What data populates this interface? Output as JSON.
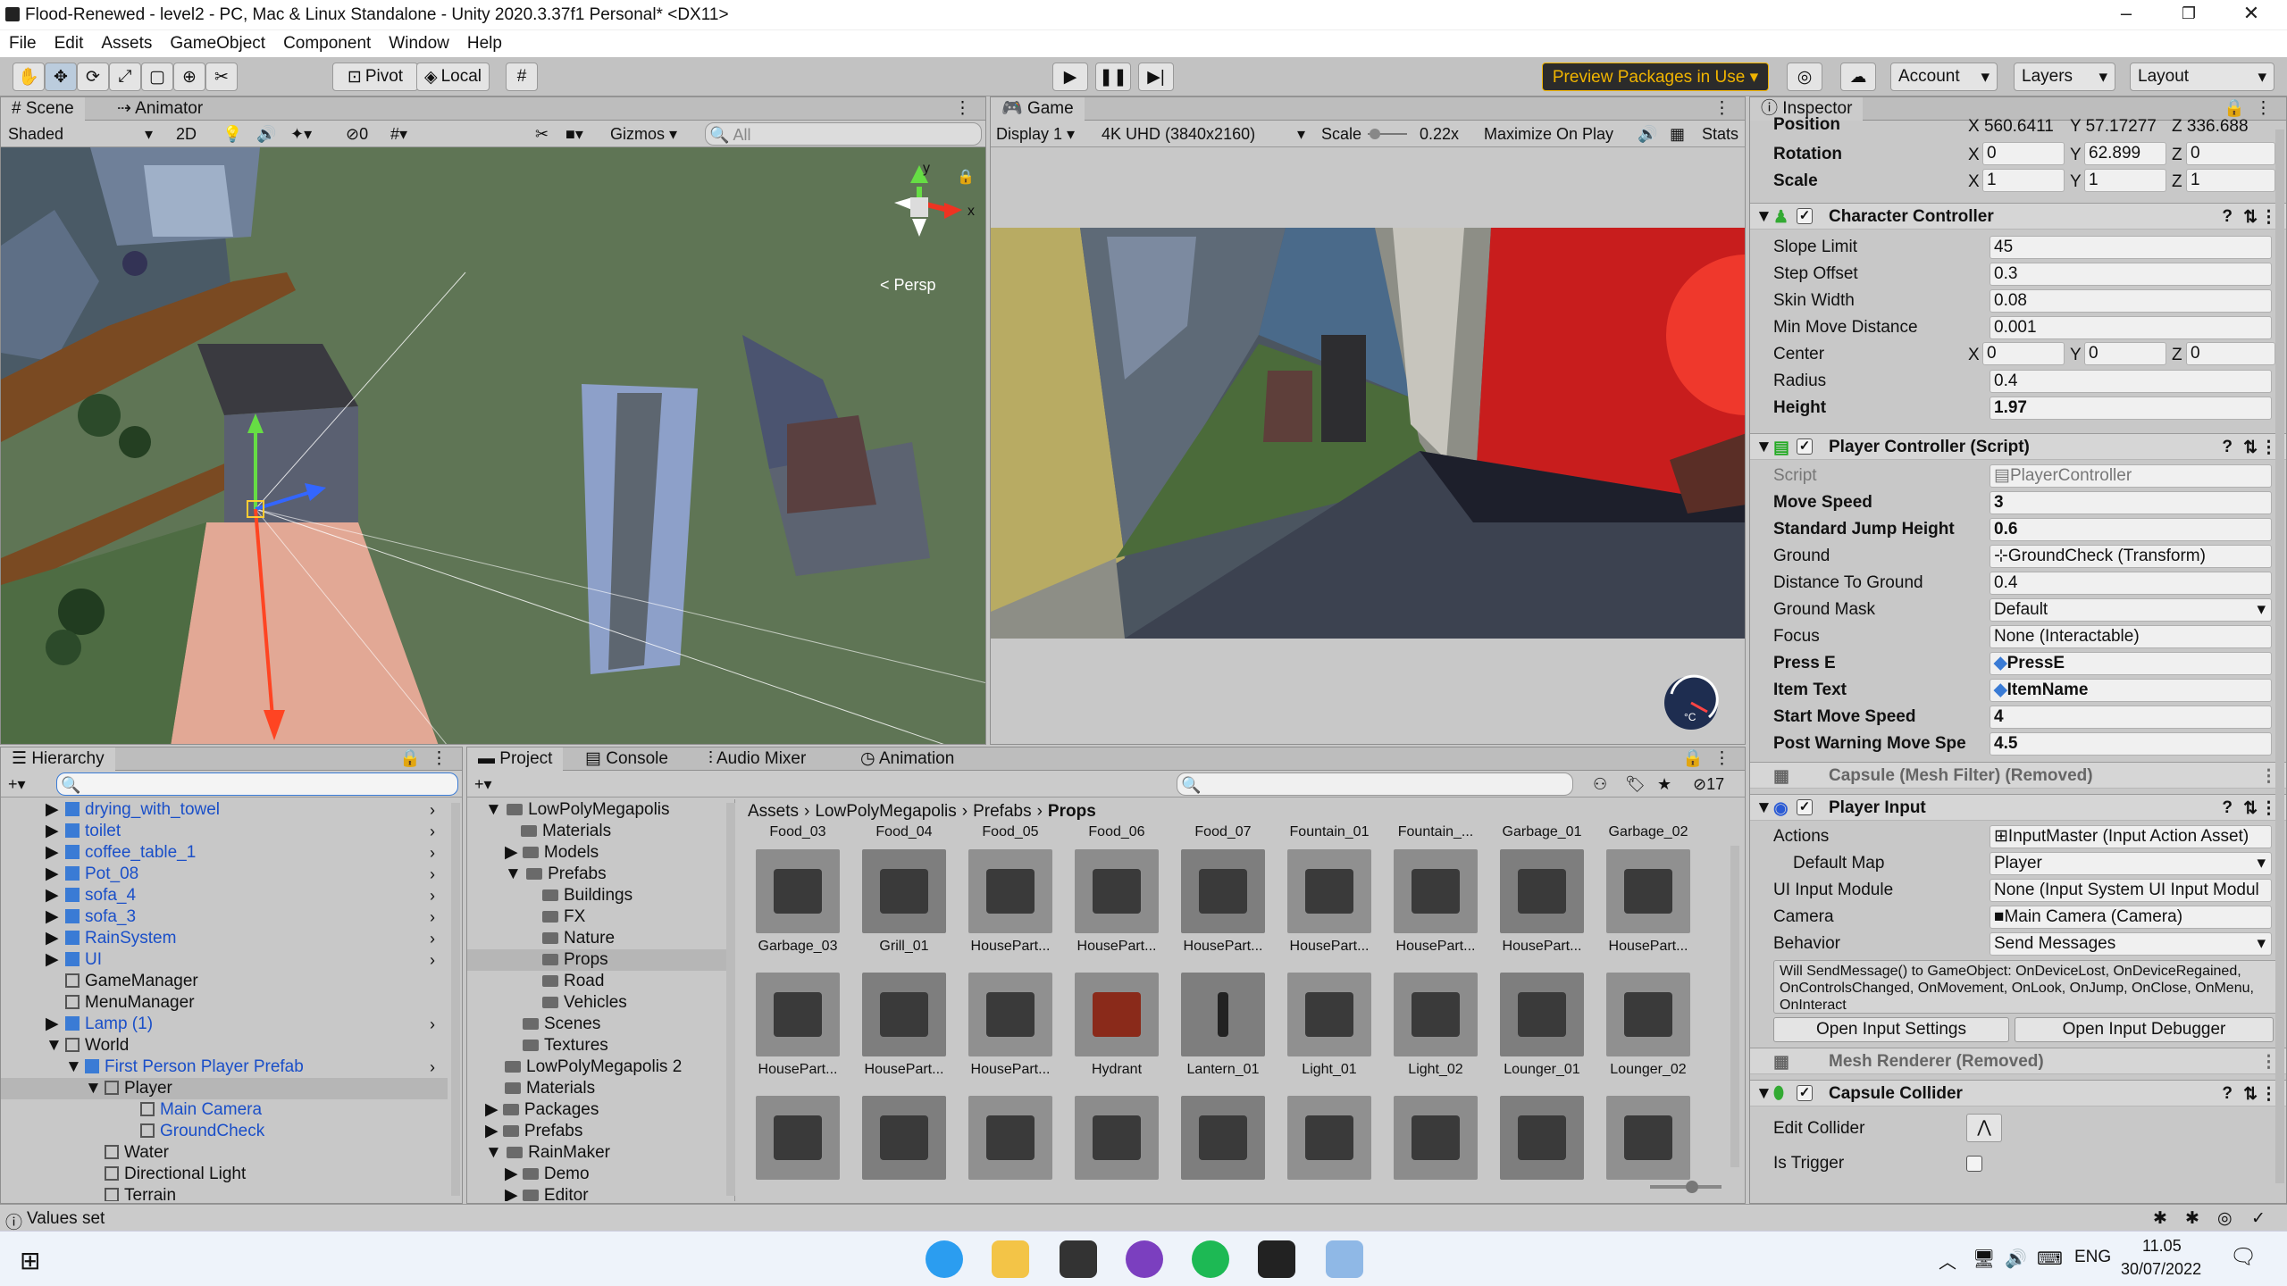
{
  "window": {
    "title": "Flood-Renewed - level2 - PC, Mac & Linux Standalone - Unity 2020.3.37f1 Personal* <DX11>"
  },
  "menu": [
    "File",
    "Edit",
    "Assets",
    "GameObject",
    "Component",
    "Window",
    "Help"
  ],
  "toolbar": {
    "pivot": "Pivot",
    "local": "Local",
    "preview_packages": "Preview Packages in Use ▾",
    "account": "Account",
    "layers": "Layers",
    "layout": "Layout"
  },
  "scene": {
    "tabs": {
      "scene": "Scene",
      "animator": "Animator"
    },
    "shading": "Shaded",
    "mode_2d": "2D",
    "hidden_count": "0",
    "gizmos": "Gizmos",
    "search_placeholder": "All",
    "persp": "< Persp",
    "axis_y": "y",
    "axis_x": "x"
  },
  "game": {
    "tab": "Game",
    "display": "Display 1",
    "resolution": "4K UHD (3840x2160)",
    "scale_label": "Scale",
    "scale_value": "0.22x",
    "maximize": "Maximize On Play",
    "stats": "Stats",
    "hud_unit": "°C"
  },
  "inspector": {
    "tab": "Inspector",
    "transform": {
      "position_label": "Position",
      "position": {
        "x": "560.6411",
        "y": "57.17277",
        "z": "336.688"
      },
      "rotation_label": "Rotation",
      "rotation": {
        "x": "0",
        "y": "62.899",
        "z": "0"
      },
      "scale_label": "Scale",
      "scale": {
        "x": "1",
        "y": "1",
        "z": "1"
      }
    },
    "character_controller": {
      "title": "Character Controller",
      "rows": [
        {
          "label": "Slope Limit",
          "value": "45"
        },
        {
          "label": "Step Offset",
          "value": "0.3"
        },
        {
          "label": "Skin Width",
          "value": "0.08"
        },
        {
          "label": "Min Move Distance",
          "value": "0.001"
        }
      ],
      "center_label": "Center",
      "center": {
        "x": "0",
        "y": "0",
        "z": "0"
      },
      "radius_label": "Radius",
      "radius": "0.4",
      "height_label": "Height",
      "height": "1.97"
    },
    "player_controller": {
      "title": "Player Controller (Script)",
      "script_label": "Script",
      "script_value": "PlayerController",
      "rows": [
        {
          "label": "Move Speed",
          "value": "3"
        },
        {
          "label": "Standard Jump Height",
          "value": "0.6"
        },
        {
          "label": "Ground",
          "value": "GroundCheck (Transform)"
        },
        {
          "label": "Distance To Ground",
          "value": "0.4"
        },
        {
          "label": "Ground Mask",
          "value": "Default"
        },
        {
          "label": "Focus",
          "value": "None (Interactable)"
        },
        {
          "label": "Press E",
          "value": "PressE"
        },
        {
          "label": "Item Text",
          "value": "ItemName"
        },
        {
          "label": "Start Move Speed",
          "value": "4"
        },
        {
          "label": "Post Warning Move Spe",
          "value": "4.5"
        }
      ]
    },
    "capsule_mesh_filter": "Capsule (Mesh Filter) (Removed)",
    "player_input": {
      "title": "Player Input",
      "rows": [
        {
          "label": "Actions",
          "value": "InputMaster (Input Action Asset)"
        },
        {
          "label": "Default Map",
          "value": "Player"
        },
        {
          "label": "UI Input Module",
          "value": "None (Input System UI Input Modul"
        },
        {
          "label": "Camera",
          "value": "Main Camera (Camera)"
        },
        {
          "label": "Behavior",
          "value": "Send Messages"
        }
      ],
      "help": "Will SendMessage() to GameObject: OnDeviceLost, OnDeviceRegained, OnControlsChanged, OnMovement, OnLook, OnJump, OnClose, OnMenu, OnInteract",
      "open_settings": "Open Input Settings",
      "open_debugger": "Open Input Debugger"
    },
    "mesh_renderer": "Mesh Renderer (Removed)",
    "capsule_collider": {
      "title": "Capsule Collider",
      "edit_collider": "Edit Collider",
      "is_trigger": "Is Trigger"
    }
  },
  "hierarchy": {
    "tab": "Hierarchy",
    "items": [
      {
        "label": "drying_with_towel",
        "blue": true
      },
      {
        "label": "toilet",
        "blue": true
      },
      {
        "label": "coffee_table_1",
        "blue": true
      },
      {
        "label": "Pot_08",
        "blue": true
      },
      {
        "label": "sofa_4",
        "blue": true
      },
      {
        "label": "sofa_3",
        "blue": true
      },
      {
        "label": "RainSystem",
        "blue": true
      },
      {
        "label": "UI",
        "blue": true
      },
      {
        "label": "GameManager",
        "blue": false
      },
      {
        "label": "MenuManager",
        "blue": false
      },
      {
        "label": "Lamp (1)",
        "blue": true
      },
      {
        "label": "World",
        "blue": false
      },
      {
        "label": "First Person Player Prefab",
        "blue": true
      },
      {
        "label": "Player",
        "blue": false
      },
      {
        "label": "Main Camera",
        "blue": true
      },
      {
        "label": "GroundCheck",
        "blue": true
      },
      {
        "label": "Water",
        "blue": false
      },
      {
        "label": "Directional Light",
        "blue": false
      },
      {
        "label": "Terrain",
        "blue": false
      }
    ]
  },
  "project": {
    "tabs": {
      "project": "Project",
      "console": "Console",
      "audio_mixer": "Audio Mixer",
      "animation": "Animation"
    },
    "hidden_count": "17",
    "tree": [
      {
        "label": "LowPolyMegapolis",
        "level": 1
      },
      {
        "label": "Materials",
        "level": 2
      },
      {
        "label": "Models",
        "level": 2
      },
      {
        "label": "Prefabs",
        "level": 2
      },
      {
        "label": "Buildings",
        "level": 3
      },
      {
        "label": "FX",
        "level": 3
      },
      {
        "label": "Nature",
        "level": 3
      },
      {
        "label": "Props",
        "level": 3
      },
      {
        "label": "Road",
        "level": 3
      },
      {
        "label": "Vehicles",
        "level": 3
      },
      {
        "label": "Scenes",
        "level": 2
      },
      {
        "label": "Textures",
        "level": 2
      },
      {
        "label": "LowPolyMegapolis 2",
        "level": 1
      },
      {
        "label": "Materials",
        "level": 1
      },
      {
        "label": "Packages",
        "level": 1
      },
      {
        "label": "Prefabs",
        "level": 1
      },
      {
        "label": "RainMaker",
        "level": 1
      },
      {
        "label": "Demo",
        "level": 2
      },
      {
        "label": "Editor",
        "level": 2
      }
    ],
    "breadcrumb": [
      "Assets",
      "LowPolyMegapolis",
      "Prefabs",
      "Props"
    ],
    "top_labels": [
      "Food_03",
      "Food_04",
      "Food_05",
      "Food_06",
      "Food_07",
      "Fountain_01",
      "Fountain_...",
      "Garbage_01",
      "Garbage_02"
    ],
    "row1": [
      "Garbage_03",
      "Grill_01",
      "HousePart...",
      "HousePart...",
      "HousePart...",
      "HousePart...",
      "HousePart...",
      "HousePart...",
      "HousePart..."
    ],
    "row2": [
      "HousePart...",
      "HousePart...",
      "HousePart...",
      "Hydrant",
      "Lantern_01",
      "Light_01",
      "Light_02",
      "Lounger_01",
      "Lounger_02"
    ]
  },
  "status": {
    "message": "Values set"
  },
  "taskbar": {
    "language": "ENG",
    "time": "11.05",
    "date": "30/07/2022"
  }
}
